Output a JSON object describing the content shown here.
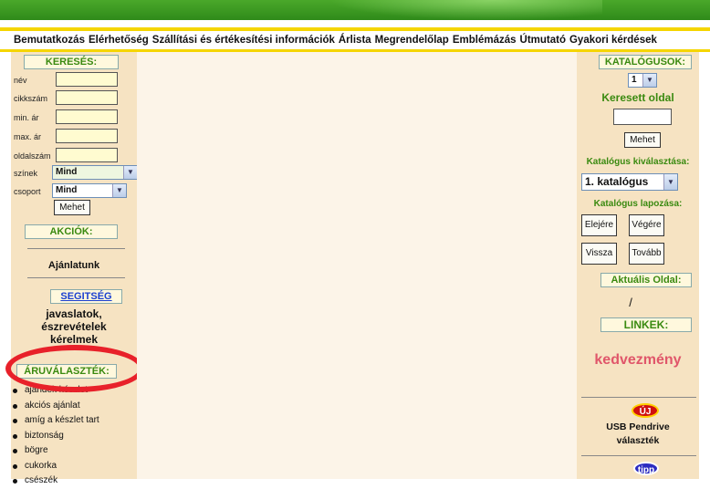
{
  "nav": [
    "Bemutatkozás",
    "Elérhetőség",
    "Szállítási és értékesítési információk",
    "Árlista",
    "Megrendelőlap",
    "Emblémázás",
    "Útmutató",
    "Gyakori kérdések"
  ],
  "left": {
    "search_title": "KERESÉS:",
    "fields": [
      "név",
      "cikkszám",
      "min. ár",
      "max. ár",
      "oldalszám"
    ],
    "szinek_label": "színek",
    "szinek_value": "Mind",
    "csoport_label": "csoport",
    "csoport_value": "Mind",
    "go_button": "Mehet",
    "akciok_title": "AKCIÓK:",
    "ajanlatunk": "Ajánlatunk",
    "segitseg_link": "SEGITSÉG",
    "help_text_1": "javaslatok,",
    "help_text_2": "észrevételek",
    "help_text_3": "kérelmek",
    "aru_title": "ÁRUVÁLASZTÉK:",
    "categories": [
      "ajándék készlet",
      "akciós ajánlat",
      "amíg a készlet tart",
      "biztonság",
      "bögre",
      "cukorka",
      "csészék"
    ]
  },
  "right": {
    "katalogusok_title": "KATALÓGUSOK:",
    "katalogus_num": "1",
    "keresett_oldal": "Keresett oldal",
    "go_button": "Mehet",
    "kivalasztasa": "Katalógus kiválasztása:",
    "katalogus_select": "1. katalógus",
    "lapozasa": "Katalógus lapozása:",
    "btn_elejere": "Elejére",
    "btn_vegere": "Végére",
    "btn_vissza": "Vissza",
    "btn_tovabb": "Tovább",
    "aktualis_title": "Aktuális Oldal:",
    "aktualis_value": "/",
    "linkek_title": "LINKEK:",
    "kedvezmeny": "kedvezmény",
    "uj_badge": "ÚJ",
    "usb_line1": "USB Pendrive",
    "usb_line2": "választék",
    "tipp_badge": "tipp"
  },
  "colors": {
    "green_header": "#3a8a10",
    "highlight_ellipse": "#e8212a",
    "kedvezmeny": "#e0566a"
  }
}
